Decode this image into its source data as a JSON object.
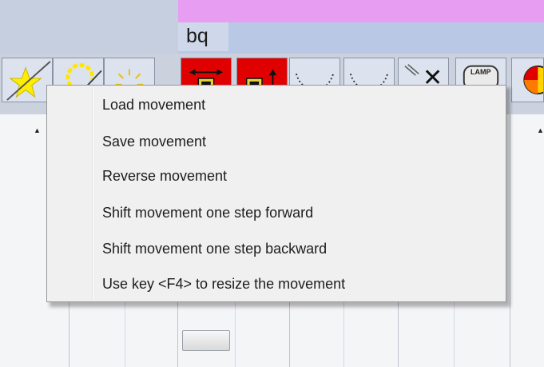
{
  "header": {
    "title": "bq"
  },
  "toolbar": {
    "buttons": [
      {
        "name": "star-icon"
      },
      {
        "name": "dimmer-icon"
      },
      {
        "name": "sun-icon"
      },
      {
        "name": "move-horizontal-icon"
      },
      {
        "name": "move-up-icon"
      },
      {
        "name": "curve-icon"
      },
      {
        "name": "curve-icon"
      },
      {
        "name": "close-icon"
      },
      {
        "name": "lamp-icon",
        "label": "LAMP"
      },
      {
        "name": "color-wheel-icon"
      }
    ]
  },
  "menu": {
    "items": [
      {
        "label": "Load movement"
      },
      {
        "label": "Save movement"
      },
      {
        "label": "Reverse movement"
      },
      {
        "label": "Shift movement one step forward"
      },
      {
        "label": "Shift movement one step backward"
      },
      {
        "label": "Use key <F4> to resize the movement"
      }
    ]
  },
  "colors": {
    "header_left": "#c6cfe0",
    "header_pink": "#e79ef2",
    "header_blue": "#b9c8e4",
    "toolbar_bg": "#cbd1dd",
    "button_red": "#e10000",
    "menu_bg": "#f0f0f0"
  }
}
